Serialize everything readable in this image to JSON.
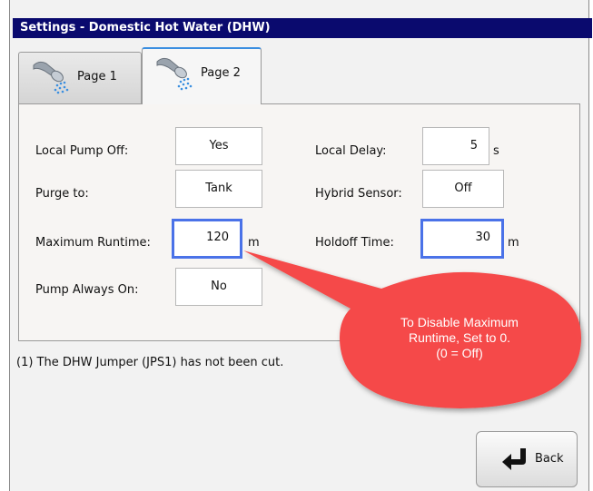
{
  "title": "Settings - Domestic Hot Water (DHW)",
  "tabs": [
    {
      "label": "Page 1",
      "icon": "shower-icon",
      "active": false
    },
    {
      "label": "Page 2",
      "icon": "shower-icon",
      "active": true
    }
  ],
  "fields": {
    "local_pump_off": {
      "label": "Local Pump Off:",
      "value": "Yes"
    },
    "purge_to": {
      "label": "Purge to:",
      "value": "Tank"
    },
    "maximum_runtime": {
      "label": "Maximum Runtime:",
      "value": "120",
      "unit": "m"
    },
    "pump_always_on": {
      "label": "Pump Always On:",
      "value": "No"
    },
    "local_delay": {
      "label": "Local Delay:",
      "value": "5",
      "unit": "s"
    },
    "hybrid_sensor": {
      "label": "Hybrid Sensor:",
      "value": "Off"
    },
    "holdoff_time": {
      "label": "Holdoff Time:",
      "value": "30",
      "unit": "m"
    }
  },
  "note": "(1) The DHW Jumper (JPS1) has not been cut.",
  "callout": {
    "text": "To Disable Maximum\nRuntime, Set to 0.\n(0 = Off)",
    "color": "#f54a4a"
  },
  "back_button": {
    "label": "Back",
    "icon": "back-arrow-icon"
  },
  "colors": {
    "titlebar": "#0a0a6e",
    "highlight": "#4a72e8"
  }
}
